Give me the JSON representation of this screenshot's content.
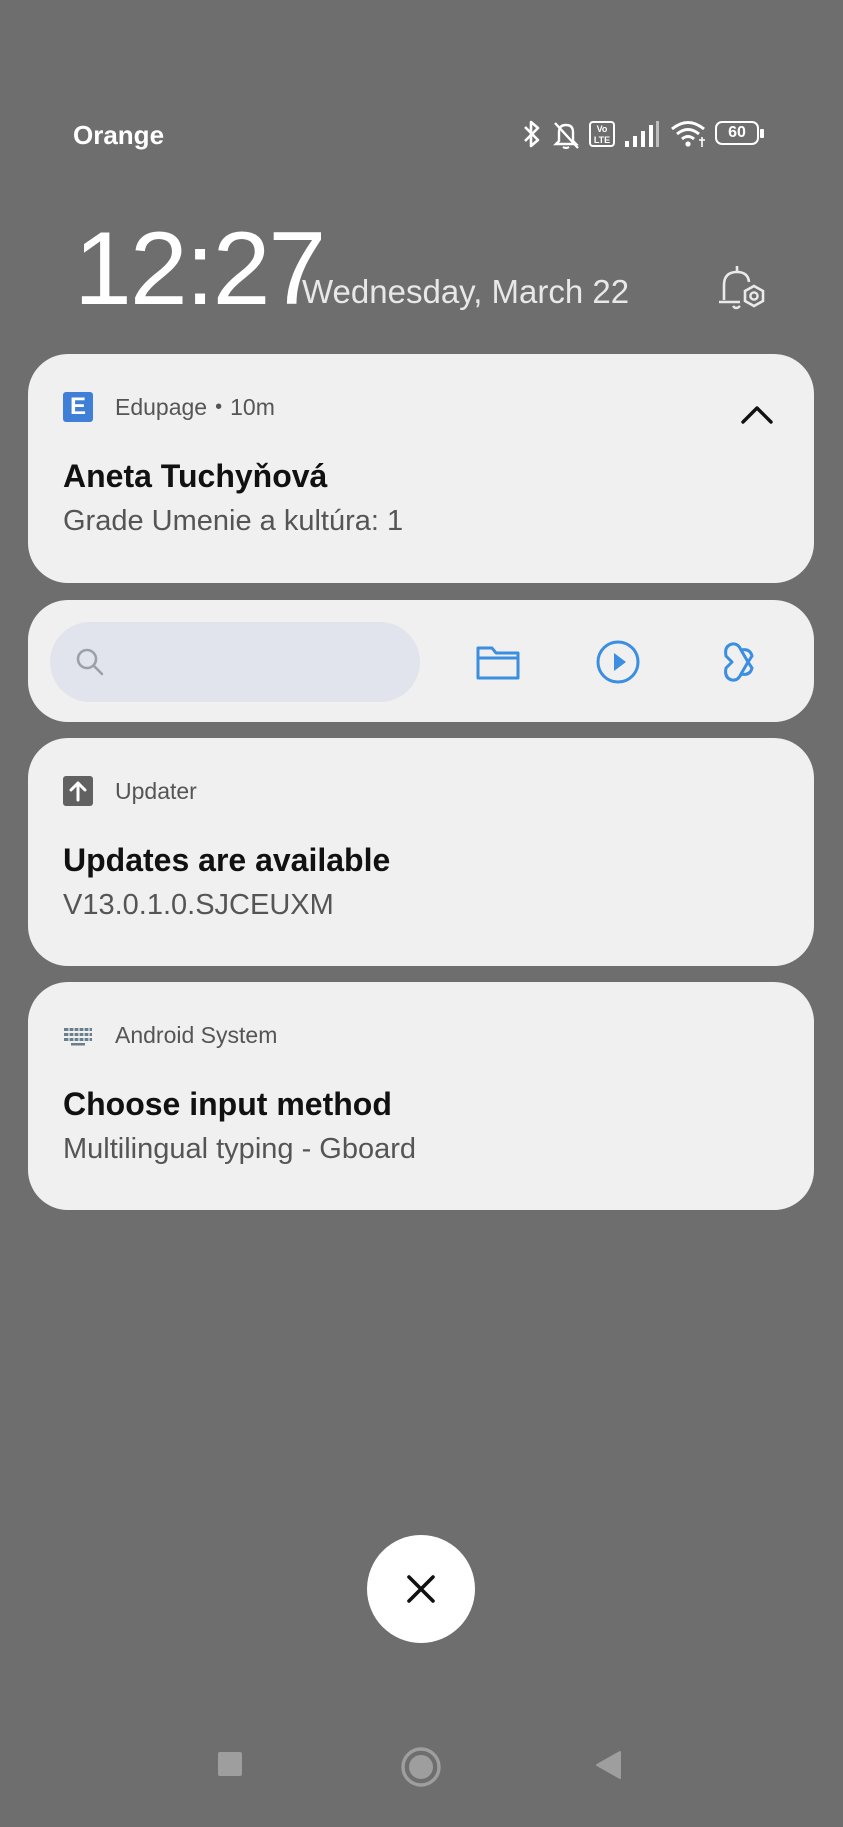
{
  "status_bar": {
    "carrier": "Orange",
    "volte_label": "Vo LTE",
    "battery_level": "60"
  },
  "lockscreen": {
    "time": "12:27",
    "date": "Wednesday, March 22"
  },
  "notifications": [
    {
      "app": "Edupage",
      "age": "10m",
      "title": "Aneta Tuchyňová",
      "text": "Grade Umenie a kultúra: 1",
      "icon": "edupage-icon",
      "icon_letter": "E"
    },
    {
      "app": "Updater",
      "title": "Updates are available",
      "text": "V13.0.1.0.SJCEUXM",
      "icon": "upload-arrow-icon"
    },
    {
      "app": "Android System",
      "title": "Choose input method",
      "text": "Multilingual typing - Gboard",
      "icon": "keyboard-icon"
    }
  ],
  "colors": {
    "background": "#6e6e6e",
    "card": "#f0f0f0",
    "accent": "#3b8ee0",
    "edupage_blue": "#3f7fd6"
  }
}
